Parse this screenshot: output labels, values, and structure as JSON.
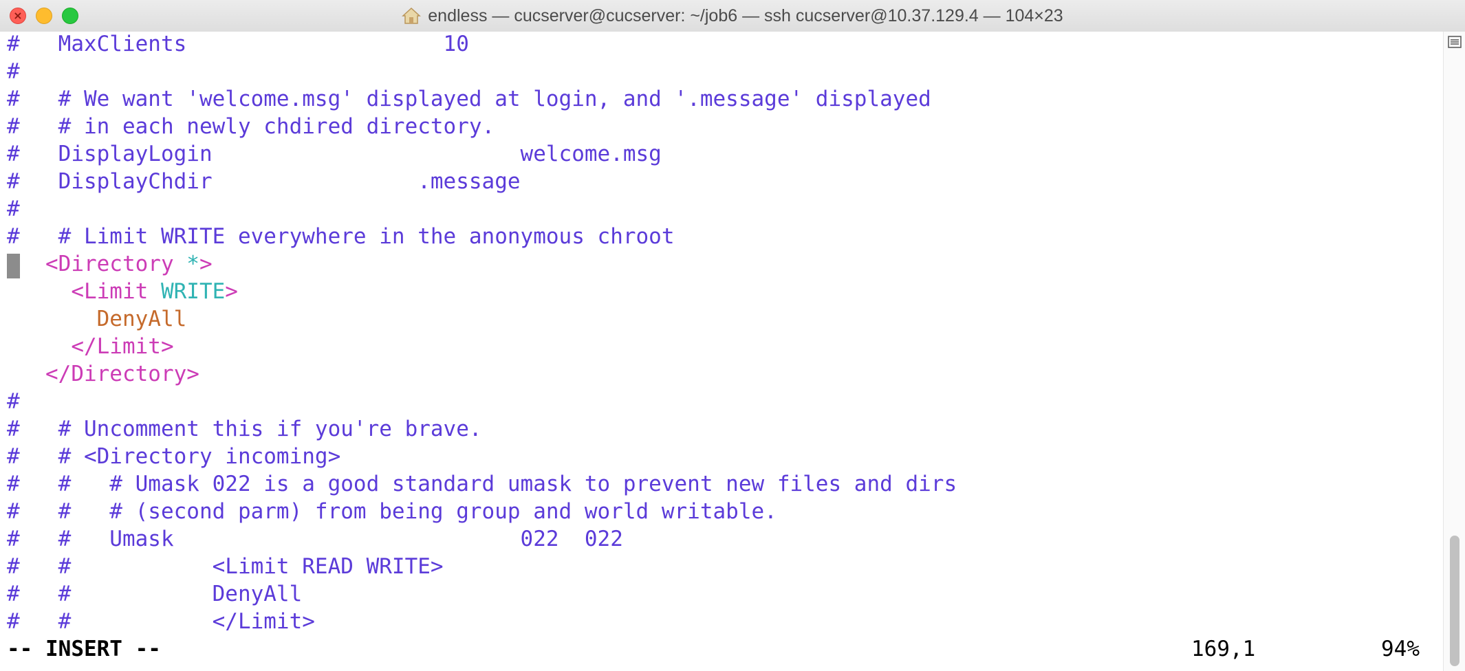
{
  "window": {
    "title": "endless — cucserver@cucserver: ~/job6 — ssh cucserver@10.37.129.4 — 104×23",
    "close_glyph": "×"
  },
  "editor": {
    "lines": [
      [
        {
          "t": "#   MaxClients                    10",
          "c": "comment"
        }
      ],
      [
        {
          "t": "#",
          "c": "comment"
        }
      ],
      [
        {
          "t": "#   # We want 'welcome.msg' displayed at login, and '.message' displayed",
          "c": "comment"
        }
      ],
      [
        {
          "t": "#   # in each newly chdired directory.",
          "c": "comment"
        }
      ],
      [
        {
          "t": "#   DisplayLogin                        welcome.msg",
          "c": "comment"
        }
      ],
      [
        {
          "t": "#   DisplayChdir                .message",
          "c": "comment"
        }
      ],
      [
        {
          "t": "#",
          "c": "comment"
        }
      ],
      [
        {
          "t": "#   # Limit WRITE everywhere in the anonymous chroot",
          "c": "comment"
        }
      ],
      [
        {
          "t": "   <Directory ",
          "c": "tag"
        },
        {
          "t": "*",
          "c": "arg"
        },
        {
          "t": ">",
          "c": "tag"
        }
      ],
      [
        {
          "t": "     <Limit ",
          "c": "tag"
        },
        {
          "t": "WRITE",
          "c": "arg"
        },
        {
          "t": ">",
          "c": "tag"
        }
      ],
      [
        {
          "t": "       DenyAll",
          "c": "kw"
        }
      ],
      [
        {
          "t": "     </Limit>",
          "c": "tag"
        }
      ],
      [
        {
          "t": "   </Directory>",
          "c": "tag"
        }
      ],
      [
        {
          "t": "#",
          "c": "comment"
        }
      ],
      [
        {
          "t": "#   # Uncomment this if you're brave.",
          "c": "comment"
        }
      ],
      [
        {
          "t": "#   # <Directory incoming>",
          "c": "comment"
        }
      ],
      [
        {
          "t": "#   #   # Umask 022 is a good standard umask to prevent new files and dirs",
          "c": "comment"
        }
      ],
      [
        {
          "t": "#   #   # (second parm) from being group and world writable.",
          "c": "comment"
        }
      ],
      [
        {
          "t": "#   #   Umask                           022  022",
          "c": "comment"
        }
      ],
      [
        {
          "t": "#   #           <Limit READ WRITE>",
          "c": "comment"
        }
      ],
      [
        {
          "t": "#   #           DenyAll",
          "c": "comment"
        }
      ],
      [
        {
          "t": "#   #           </Limit>",
          "c": "comment"
        }
      ]
    ],
    "mode": "-- INSERT --",
    "position": "169,1",
    "percent": "94%"
  },
  "colors": {
    "comment": "#5b3bd9",
    "tag": "#cc3cb6",
    "arg": "#2fb3b3",
    "keyword": "#c56a2b"
  },
  "icons": {
    "title_icon": "home-icon",
    "scrollbar_menu": "menu-icon"
  }
}
